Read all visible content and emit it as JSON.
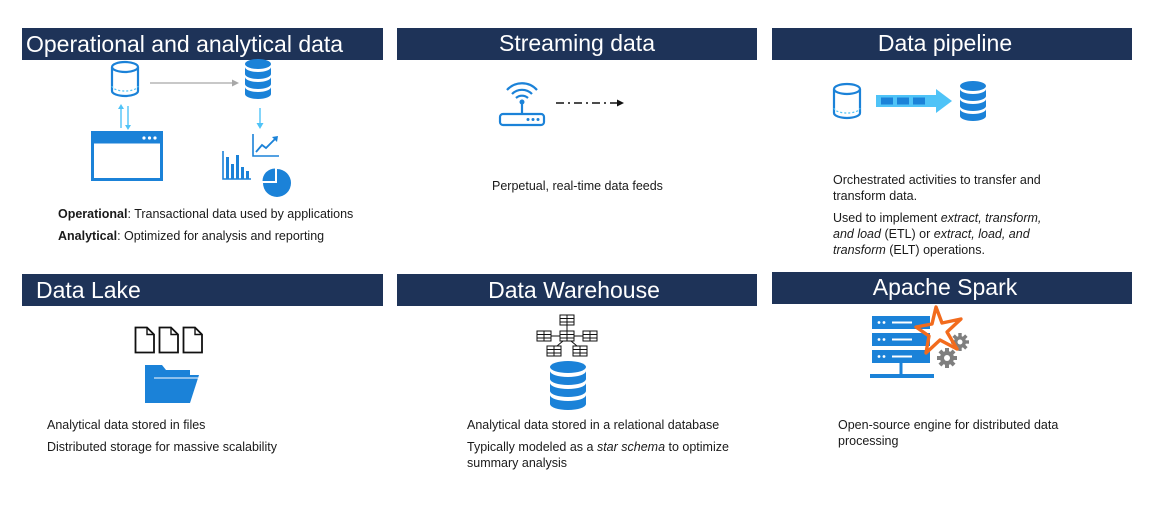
{
  "panels": {
    "operational": {
      "title": "Operational and analytical data",
      "line1_term": "Operational",
      "line1_rest": ": Transactional data used by applications",
      "line2_term": "Analytical",
      "line2_rest": ": Optimized for analysis and reporting",
      "icons": [
        "database-cylinder-icon",
        "application-window-icon",
        "database-stack-icon",
        "bar-chart-icon",
        "line-chart-icon",
        "pie-chart-icon"
      ]
    },
    "streaming": {
      "title": "Streaming data",
      "desc": "Perpetual, real-time data feeds",
      "icons": [
        "wireless-router-icon",
        "dash-dot-arrow-icon"
      ]
    },
    "pipeline": {
      "title": "Data pipeline",
      "desc1": "Orchestrated activities to transfer and transform data.",
      "desc2_a": "Used to implement ",
      "desc2_em1": "extract, transform, and load",
      "desc2_b": " (ETL) or ",
      "desc2_em2": "extract, load, and transform",
      "desc2_c": " (ELT) operations.",
      "icons": [
        "database-cylinder-icon",
        "pipeline-arrow-icon",
        "database-stack-icon"
      ]
    },
    "lake": {
      "title": "Data Lake",
      "desc1": "Analytical data stored in files",
      "desc2": "Distributed storage for massive scalability",
      "icons": [
        "documents-icon",
        "folder-icon"
      ]
    },
    "warehouse": {
      "title": "Data Warehouse",
      "desc1": "Analytical data stored in a relational database",
      "desc2_a": "Typically modeled as a ",
      "desc2_em": "star schema",
      "desc2_b": " to optimize summary analysis",
      "icons": [
        "star-schema-tables-icon",
        "database-stack-icon"
      ]
    },
    "spark": {
      "title": "Apache Spark",
      "desc": "Open-source engine for distributed data processing",
      "icons": [
        "server-stack-icon",
        "spark-star-icon",
        "gears-icon"
      ]
    }
  },
  "colors": {
    "header_bg": "#1e3358",
    "accent_blue": "#1b82d8",
    "light_blue": "#4fc3f7",
    "spark_orange": "#f26b1d",
    "icon_gray": "#8a8a8a"
  }
}
